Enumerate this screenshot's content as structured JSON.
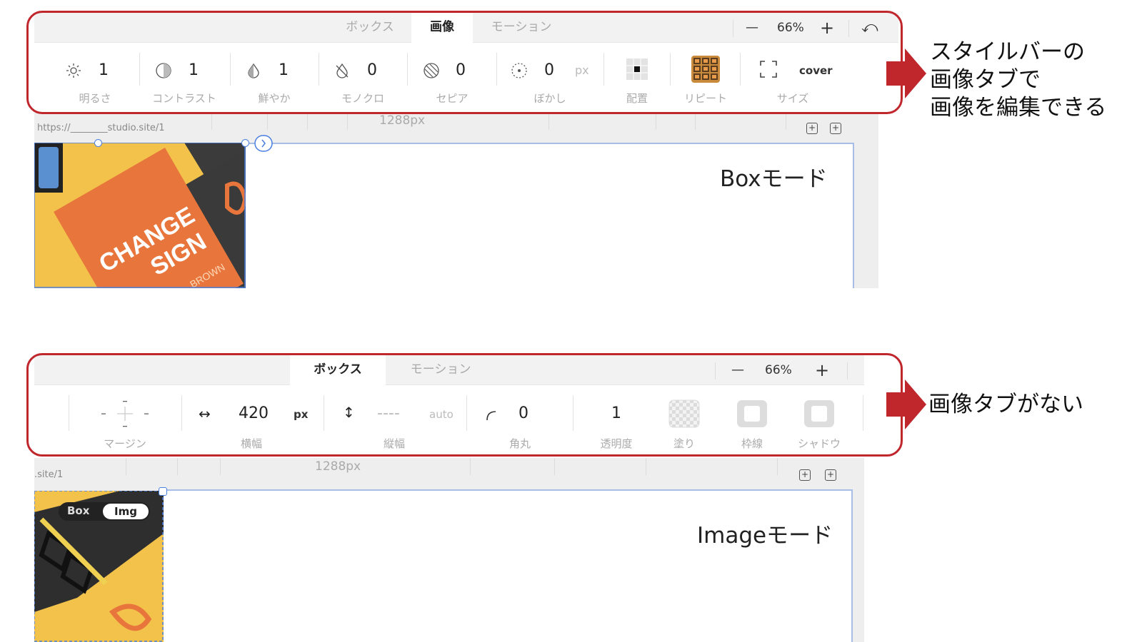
{
  "top": {
    "tabs": [
      {
        "label": "ボックス",
        "active": false
      },
      {
        "label": "画像",
        "active": true
      },
      {
        "label": "モーション",
        "active": false
      }
    ],
    "zoom": {
      "minus": "—",
      "value": "66%",
      "plus": "+",
      "undo": "⤺"
    },
    "controls": {
      "brightness": {
        "value": "1",
        "label": "明るさ"
      },
      "contrast": {
        "value": "1",
        "label": "コントラスト"
      },
      "saturation": {
        "value": "1",
        "label": "鮮やか"
      },
      "grayscale": {
        "value": "0",
        "label": "モノクロ"
      },
      "sepia": {
        "value": "0",
        "label": "セピア"
      },
      "blur": {
        "value": "0",
        "unit": "px",
        "label": "ぼかし"
      },
      "position": {
        "label": "配置"
      },
      "repeat": {
        "label": "リピート"
      },
      "size": {
        "value": "cover",
        "label": "サイズ"
      }
    },
    "canvas": {
      "url": "https://________studio.site/1",
      "width_label": "1288px",
      "mode_label": "Boxモード"
    },
    "image_text": {
      "line1": "CHANGE",
      "line2": "SIGN",
      "line3": "BROWN"
    }
  },
  "bottom": {
    "tabs": [
      {
        "label": "ボックス",
        "active": true
      },
      {
        "label": "モーション",
        "active": false
      }
    ],
    "zoom": {
      "minus": "—",
      "value": "66%",
      "plus": "+"
    },
    "controls": {
      "margin": {
        "label": "マージン"
      },
      "width": {
        "value": "420",
        "unit": "px",
        "label": "横幅"
      },
      "height": {
        "value": "----",
        "unit": "auto",
        "label": "縦幅"
      },
      "radius": {
        "value": "0",
        "label": "角丸"
      },
      "opacity": {
        "value": "1",
        "label": "透明度"
      },
      "fill": {
        "label": "塗り"
      },
      "border": {
        "label": "枠線"
      },
      "shadow": {
        "label": "シャドウ"
      }
    },
    "canvas": {
      "url": ".site/1",
      "width_label": "1288px",
      "mode_label": "Imageモード",
      "toggle_box": "Box",
      "toggle_img": "Img"
    }
  },
  "notes": {
    "top_line1": "スタイルバーの",
    "top_line2": "画像タブで",
    "top_line3": "画像を編集できる",
    "bottom": "画像タブがない"
  },
  "colors": {
    "highlight": "#c0272d",
    "arrow": "#c0272d",
    "frame": "#a8bde6",
    "image_yellow": "#f2c24b",
    "book_orange": "#e8763c"
  }
}
